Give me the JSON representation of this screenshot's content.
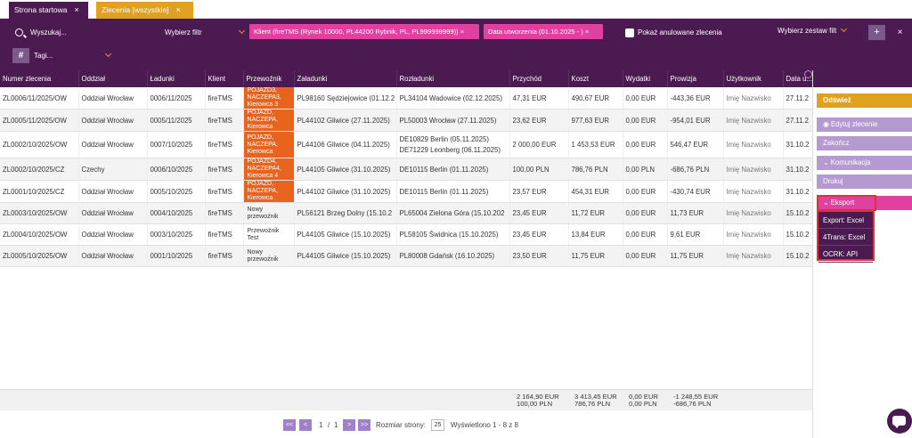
{
  "tabs": [
    {
      "label": "Strona startowa",
      "close": "×"
    },
    {
      "label": "Zlecenia [wszystkie]",
      "close": "×"
    }
  ],
  "filters": {
    "search_placeholder": "Wyszukaj...",
    "filter_select": "Wybierz filtr",
    "chips": [
      "Klient (fireTMS (Rynek 10000, PL44200 Rybnik, PL, PL999999999)) ×",
      "Data utworzenia (01.10.2025 - ) ×"
    ],
    "show_cancelled": "Pokaż anulowane zlecenia",
    "set_select": "Wybierz zestaw filt",
    "add": "+",
    "clear": "×",
    "tags_icon": "#",
    "tags": "Tagi..."
  },
  "table": {
    "columns": [
      "Numer zlecenia",
      "Oddział",
      "Ładunki",
      "Klient",
      "Przewoźnik",
      "Załadunki",
      "Rozładunki",
      "Przychód",
      "Koszt",
      "Wydatki",
      "Prowizja",
      "Użytkownik",
      "Data u..."
    ],
    "rows": [
      {
        "nr": "ZL0006/11/2025/OW",
        "oddzial": "Oddział Wrocław",
        "ladunki": "0006/11/2025",
        "klient": "fireTMS",
        "przewoznik": "POJAZD3, NACZEPA3, Kierowca 3",
        "zaladunki": "PL98160 Sędziejowice (01.12.2",
        "rozladunki": "PL34104 Wadowice (02.12.2025)",
        "przychod": "47,31 EUR",
        "koszt": "490,67 EUR",
        "wydatki": "0,00 EUR",
        "prowizja": "-443,36 EUR",
        "uzytkownik": "Imię Nazwisko",
        "data": "27.11.2"
      },
      {
        "nr": "ZL0005/11/2025/OW",
        "oddzial": "Oddział Wrocław",
        "ladunki": "0005/11/2025",
        "klient": "fireTMS",
        "przewoznik": "POJAZD, NACZEPA, Kierowca",
        "zaladunki": "PL44102 Gliwice (27.11.2025)",
        "rozladunki": "PL50003 Wrocław (27.11.2025)",
        "przychod": "23,62 EUR",
        "koszt": "977,63 EUR",
        "wydatki": "0,00 EUR",
        "prowizja": "-954,01 EUR",
        "uzytkownik": "Imię Nazwisko",
        "data": "27.11.2"
      },
      {
        "nr": "ZL0002/10/2025/OW",
        "oddzial": "Oddział Wrocław",
        "ladunki": "0007/10/2025",
        "klient": "fireTMS",
        "przewoznik": "POJAZD, NACZEPA, Kierowca",
        "zaladunki": "PL44106 Gliwice (04.11.2025)",
        "rozladunki": "DE10829 Berlin (05.11.2025)",
        "rozladunki2": "DE71229 Leonberg (06.11.2025)",
        "przychod": "2 000,00 EUR",
        "koszt": "1 453,53 EUR",
        "wydatki": "0,00 EUR",
        "prowizja": "546,47 EUR",
        "uzytkownik": "Imię Nazwisko",
        "data": "31.10.2"
      },
      {
        "nr": "ZL0002/10/2025/CZ",
        "oddzial": "Czechy",
        "ladunki": "0006/10/2025",
        "klient": "fireTMS",
        "przewoznik": "POJAZD4, NACZEPA4, Kierowca 4",
        "zaladunki": "PL44105 Gliwice (31.10.2025)",
        "rozladunki": "DE10115 Berlin (01.11.2025)",
        "przychod": "100,00 PLN",
        "koszt": "786,76 PLN",
        "wydatki": "0,00 PLN",
        "prowizja": "-686,76 PLN",
        "uzytkownik": "Imię Nazwisko",
        "data": "31.10.2"
      },
      {
        "nr": "ZL0001/10/2025/CZ",
        "oddzial": "Oddział Wrocław",
        "ladunki": "0005/10/2025",
        "klient": "fireTMS",
        "przewoznik": "POJAZD, NACZEPA, Kierowca",
        "zaladunki": "PL44102 Gliwice (31.10.2025)",
        "rozladunki": "DE10115 Berlin (01.11.2025)",
        "przychod": "23,57 EUR",
        "koszt": "454,31 EUR",
        "wydatki": "0,00 EUR",
        "prowizja": "-430,74 EUR",
        "uzytkownik": "Imię Nazwisko",
        "data": "31.10.2"
      },
      {
        "nr": "ZL0003/10/2025/OW",
        "oddzial": "Oddział Wrocław",
        "ladunki": "0004/10/2025",
        "klient": "fireTMS",
        "przewoznik": "Nowy przewoźnik",
        "zaladunki": "PL56121 Brzeg Dolny (15.10.2",
        "rozladunki": "PL65004 Zielona Góra (15.10.202",
        "przychod": "23,45 EUR",
        "koszt": "11,72 EUR",
        "wydatki": "0,00 EUR",
        "prowizja": "11,73 EUR",
        "uzytkownik": "Imię Nazwisko",
        "data": "15.10.2"
      },
      {
        "nr": "ZL0004/10/2025/OW",
        "oddzial": "Oddział Wrocław",
        "ladunki": "0003/10/2025",
        "klient": "fireTMS",
        "przewoznik": "Przewoźnik Test",
        "zaladunki": "PL44105 Gliwice (15.10.2025)",
        "rozladunki": "PL58105 Świdnica (15.10.2025)",
        "przychod": "23,45 EUR",
        "koszt": "13,84 EUR",
        "wydatki": "0,00 EUR",
        "prowizja": "9,61 EUR",
        "uzytkownik": "Imię Nazwisko",
        "data": "15.10.2"
      },
      {
        "nr": "ZL0005/10/2025/OW",
        "oddzial": "Oddział Wrocław",
        "ladunki": "0001/10/2025",
        "klient": "fireTMS",
        "przewoznik": "Nowy przewoźnik",
        "zaladunki": "PL44105 Gliwice (15.10.2025)",
        "rozladunki": "PL80008 Gdańsk (16.10.2025)",
        "przychod": "23,50 EUR",
        "koszt": "11,75 EUR",
        "wydatki": "0,00 EUR",
        "prowizja": "11,75 EUR",
        "uzytkownik": "Imię Nazwisko",
        "data": "15.10.2"
      }
    ]
  },
  "totals": {
    "przychod": [
      "2 164,90 EUR",
      "100,00 PLN"
    ],
    "koszt": [
      "3 413,45 EUR",
      "786,76 PLN"
    ],
    "wydatki": [
      "0,00 EUR",
      "0,00 PLN"
    ],
    "prowizja": [
      "-1 248,55 EUR",
      "-686,76 PLN"
    ]
  },
  "pager": {
    "first": "<<",
    "prev": "<",
    "page": "1",
    "sep": "/",
    "of": "1",
    "next": ">",
    "last": ">>",
    "size_label": "Rozmiar strony:",
    "size": "25",
    "shown": "Wyświetlono 1 - 8 z 8"
  },
  "sidebar": {
    "refresh": "Odśwież",
    "edit": "Edytuj zlecenie",
    "finish": "Zakończ",
    "communication": "Komunikacja",
    "print": "Drukuj",
    "export": "Eksport",
    "export_items": [
      "Export: Excel",
      "4Trans: Excel",
      "OCRK: API"
    ]
  },
  "colors": {
    "primary": "#4a1a50",
    "accent": "#e0a020",
    "pink": "#e040a0",
    "carrier": "#e8641e",
    "lavender": "#b49ad0"
  }
}
